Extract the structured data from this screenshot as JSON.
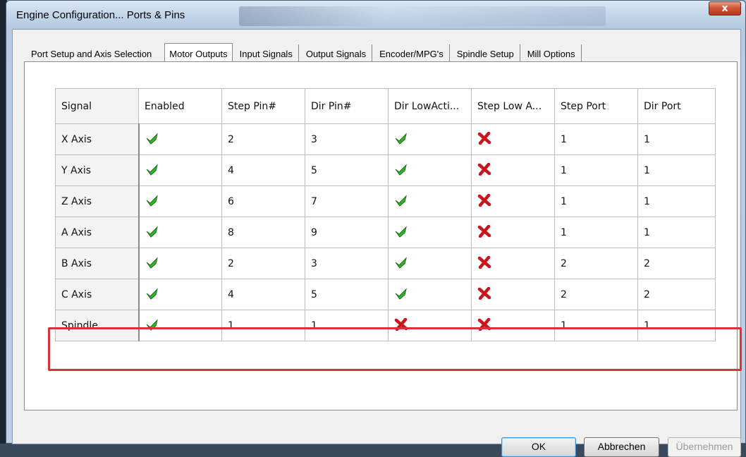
{
  "window": {
    "title": "Engine Configuration... Ports & Pins",
    "close_label": "x"
  },
  "tabs": [
    {
      "label": "Port Setup and Axis Selection",
      "active": false
    },
    {
      "label": "Motor Outputs",
      "active": true
    },
    {
      "label": "Input Signals",
      "active": false
    },
    {
      "label": "Output Signals",
      "active": false
    },
    {
      "label": "Encoder/MPG's",
      "active": false
    },
    {
      "label": "Spindle Setup",
      "active": false
    },
    {
      "label": "Mill Options",
      "active": false
    }
  ],
  "table": {
    "columns": [
      "Signal",
      "Enabled",
      "Step Pin#",
      "Dir Pin#",
      "Dir LowActi...",
      "Step Low A...",
      "Step Port",
      "Dir Port"
    ],
    "rows": [
      {
        "signal": "X Axis",
        "enabled": true,
        "step_pin": "2",
        "dir_pin": "3",
        "dir_low_active": true,
        "step_low_active": false,
        "step_port": "1",
        "dir_port": "1"
      },
      {
        "signal": "Y Axis",
        "enabled": true,
        "step_pin": "4",
        "dir_pin": "5",
        "dir_low_active": true,
        "step_low_active": false,
        "step_port": "1",
        "dir_port": "1"
      },
      {
        "signal": "Z Axis",
        "enabled": true,
        "step_pin": "6",
        "dir_pin": "7",
        "dir_low_active": true,
        "step_low_active": false,
        "step_port": "1",
        "dir_port": "1"
      },
      {
        "signal": "A Axis",
        "enabled": true,
        "step_pin": "8",
        "dir_pin": "9",
        "dir_low_active": true,
        "step_low_active": false,
        "step_port": "1",
        "dir_port": "1"
      },
      {
        "signal": "B Axis",
        "enabled": true,
        "step_pin": "2",
        "dir_pin": "3",
        "dir_low_active": true,
        "step_low_active": false,
        "step_port": "2",
        "dir_port": "2"
      },
      {
        "signal": "C Axis",
        "enabled": true,
        "step_pin": "4",
        "dir_pin": "5",
        "dir_low_active": true,
        "step_low_active": false,
        "step_port": "2",
        "dir_port": "2"
      },
      {
        "signal": "Spindle",
        "enabled": true,
        "step_pin": "1",
        "dir_pin": "1",
        "dir_low_active": false,
        "step_low_active": false,
        "step_port": "1",
        "dir_port": "1"
      }
    ]
  },
  "icons": {
    "true": "green-check-icon",
    "false": "red-x-icon"
  },
  "colors": {
    "check": "#2fb52a",
    "cross": "#c8151b",
    "highlight": "#d9323a"
  },
  "buttons": {
    "ok": "OK",
    "cancel": "Abbrechen",
    "apply": "Übernehmen"
  }
}
